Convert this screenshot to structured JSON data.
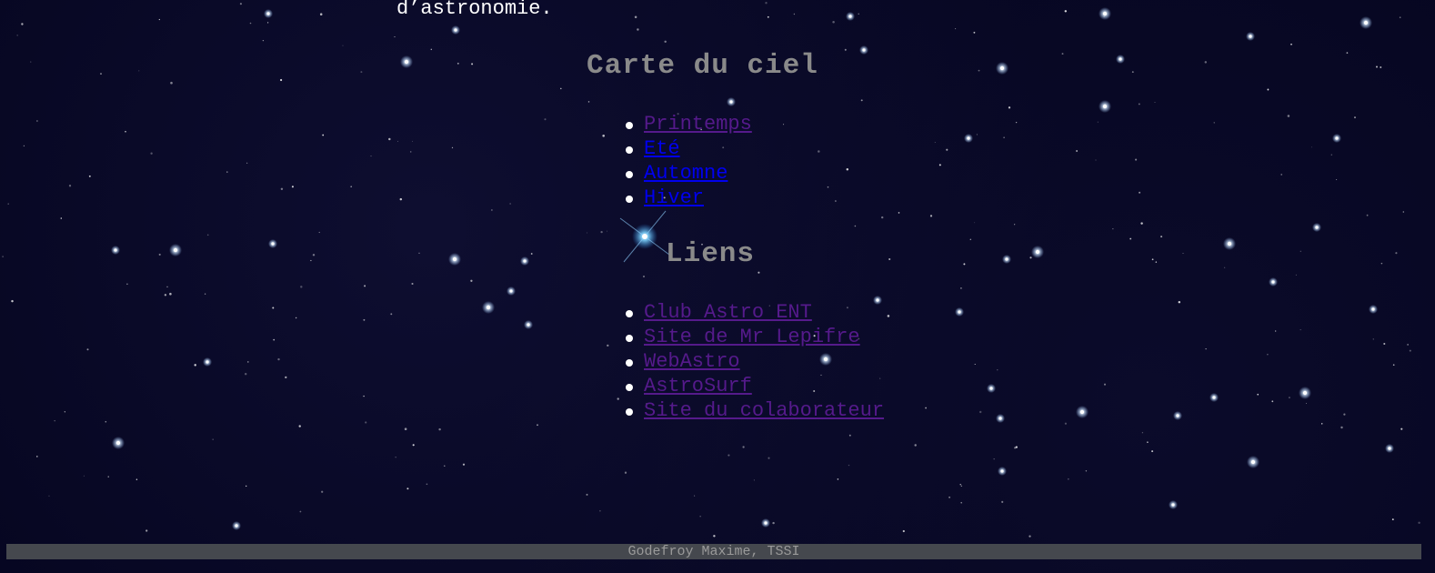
{
  "intro_text": "d’astronomie.",
  "sections": {
    "carte": {
      "title": "Carte du ciel",
      "items": [
        {
          "label": "Printemps",
          "state": "visited"
        },
        {
          "label": "Eté",
          "state": "unvisited"
        },
        {
          "label": "Automne",
          "state": "unvisited"
        },
        {
          "label": "Hiver",
          "state": "unvisited"
        }
      ]
    },
    "liens": {
      "title": "Liens",
      "items": [
        {
          "label": "Club Astro ENT",
          "state": "visited"
        },
        {
          "label": "Site de Mr Lepifre",
          "state": "visited"
        },
        {
          "label": "WebAstro",
          "state": "visited"
        },
        {
          "label": "AstroSurf",
          "state": "visited"
        },
        {
          "label": "Site du colaborateur",
          "state": "visited"
        }
      ]
    }
  },
  "footer": {
    "text": "Godefroy Maxime, TSSI"
  },
  "colors": {
    "background": "#05051f",
    "heading": "#8a8a8a",
    "link_visited": "#551a8b",
    "link_unvisited": "#0000ee",
    "footer_bar": "#45484e",
    "footer_text": "#9a9a9a"
  },
  "background_image": "starfield"
}
